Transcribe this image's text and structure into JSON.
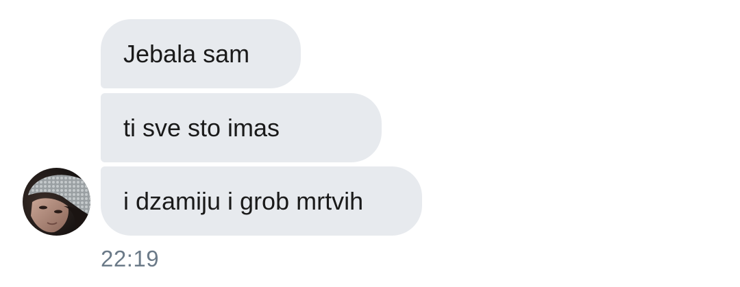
{
  "conversation": {
    "messages": [
      {
        "text": "Jebala sam"
      },
      {
        "text": "ti sve sto imas"
      },
      {
        "text": "i dzamiju i grob mrtvih"
      }
    ],
    "timestamp": "22:19",
    "colors": {
      "bubble_bg": "#e7eaee",
      "text": "#1a1a1a",
      "timestamp": "#6b7a88"
    }
  }
}
